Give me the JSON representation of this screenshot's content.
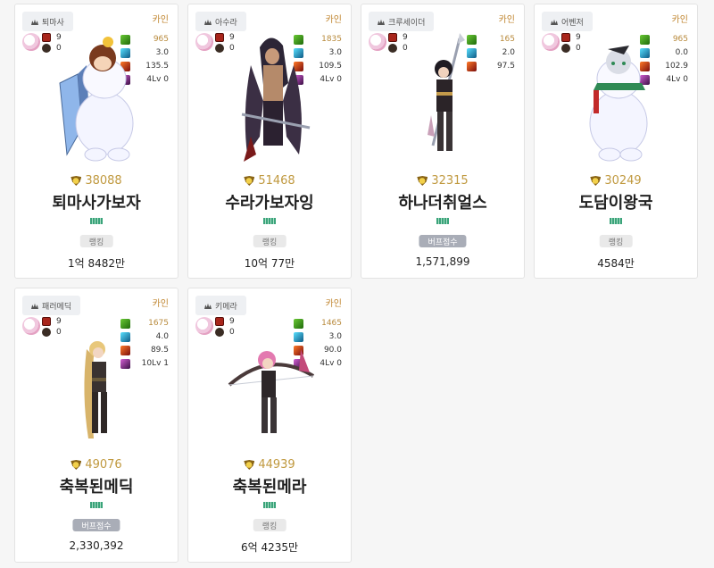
{
  "server_label": "카인",
  "cards": [
    {
      "job": "퇴마사",
      "left_stats": [
        "9",
        "0"
      ],
      "right_stats": [
        "965",
        "3.0",
        "135.5",
        "4Lv 0"
      ],
      "fame": "38088",
      "name": "퇴마사가보자",
      "badge": "랭킹",
      "value": "1억 8482만",
      "sprite": "snowman_brown"
    },
    {
      "job": "아수라",
      "left_stats": [
        "9",
        "0"
      ],
      "right_stats": [
        "1835",
        "3.0",
        "109.5",
        "4Lv 0"
      ],
      "fame": "51468",
      "name": "수라가보자잉",
      "badge": "랭킹",
      "value": "10억 77만",
      "sprite": "warrior_dark"
    },
    {
      "job": "크루세이더",
      "left_stats": [
        "9",
        "0"
      ],
      "right_stats": [
        "165",
        "2.0",
        "97.5"
      ],
      "fame": "32315",
      "name": "하나더취얼스",
      "badge": "버프점수",
      "value": "1,571,899",
      "sprite": "spear_girl"
    },
    {
      "job": "어벤저",
      "left_stats": [
        "9",
        "0"
      ],
      "right_stats": [
        "965",
        "0.0",
        "102.9",
        "4Lv 0"
      ],
      "fame": "30249",
      "name": "도담이왕국",
      "badge": "랭킹",
      "value": "4584만",
      "sprite": "snowman_white"
    },
    {
      "job": "패러메딕",
      "left_stats": [
        "9",
        "0"
      ],
      "right_stats": [
        "1675",
        "4.0",
        "89.5",
        "10Lv 1"
      ],
      "fame": "49076",
      "name": "축복된메딕",
      "badge": "버프점수",
      "value": "2,330,392",
      "sprite": "blonde_girl"
    },
    {
      "job": "키메라",
      "left_stats": [
        "9",
        "0"
      ],
      "right_stats": [
        "1465",
        "3.0",
        "90.0",
        "4Lv 0"
      ],
      "fame": "44939",
      "name": "축복된메라",
      "badge": "랭킹",
      "value": "6억 4235만",
      "sprite": "bow_girl"
    }
  ]
}
